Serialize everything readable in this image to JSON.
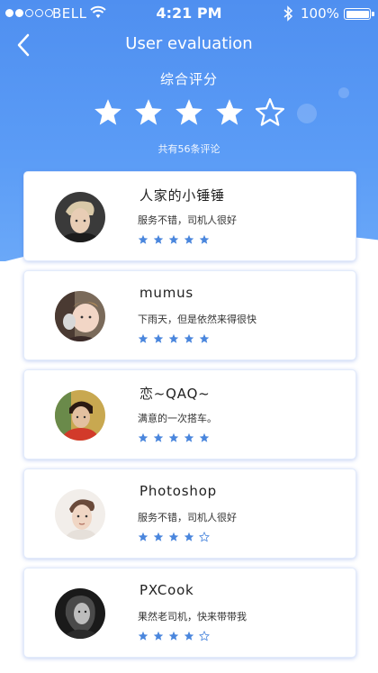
{
  "status_bar": {
    "carrier": "BELL",
    "time": "4:21 PM",
    "battery": "100%"
  },
  "nav": {
    "title": "User evaluation"
  },
  "summary": {
    "label": "综合评分",
    "rating": 4,
    "max": 5,
    "count_text": "共有56条评论"
  },
  "colors": {
    "primary": "#5b9cf6",
    "star": "#4a86dd"
  },
  "reviews": [
    {
      "name": "人家的小锤锤",
      "comment": "服务不错，司机人很好",
      "stars": 5,
      "avatar": "avatar-man-blonde"
    },
    {
      "name": "mumus",
      "comment": "下雨天，但是依然来得很快",
      "stars": 5,
      "avatar": "avatar-baby"
    },
    {
      "name": "恋~QAQ~",
      "comment": "满意的一次搭车。",
      "stars": 5,
      "avatar": "avatar-boy-red"
    },
    {
      "name": "Photoshop",
      "comment": "服务不错，司机人很好",
      "stars": 4,
      "avatar": "avatar-man-portrait"
    },
    {
      "name": "PXCook",
      "comment": "果然老司机，快来带带我",
      "stars": 4,
      "avatar": "avatar-woman-dark"
    }
  ]
}
